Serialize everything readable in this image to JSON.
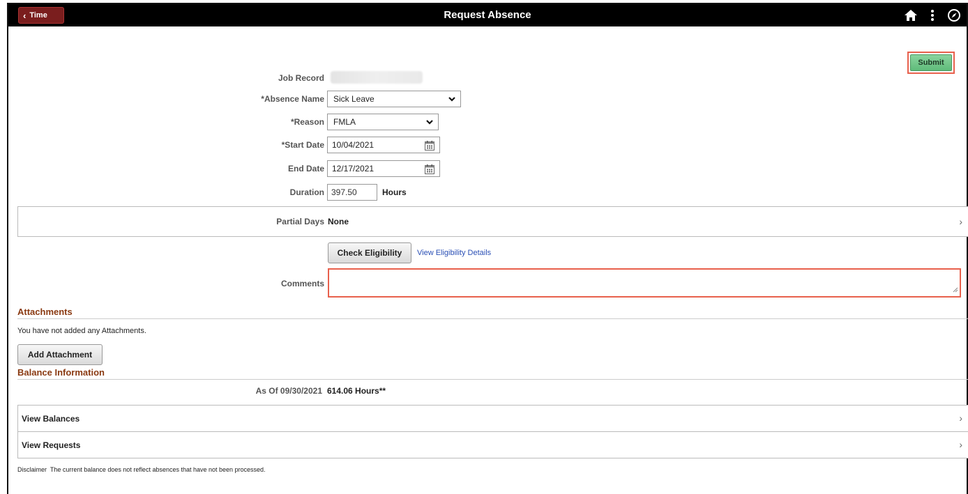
{
  "header": {
    "back_label": "Time",
    "title": "Request Absence",
    "icons": [
      "home-icon",
      "more-vertical-icon",
      "navigator-icon"
    ]
  },
  "actions": {
    "submit_label": "Submit"
  },
  "form": {
    "job_record_label": "Job Record",
    "absence_name_label": "*Absence Name",
    "absence_name_value": "Sick Leave",
    "reason_label": "*Reason",
    "reason_value": "FMLA",
    "start_date_label": "*Start Date",
    "start_date_value": "10/04/2021",
    "end_date_label": "End Date",
    "end_date_value": "12/17/2021",
    "duration_label": "Duration",
    "duration_value": "397.50",
    "duration_unit": "Hours",
    "partial_days_label": "Partial Days",
    "partial_days_value": "None",
    "check_eligibility_label": "Check Eligibility",
    "view_eligibility_link": "View Eligibility Details",
    "comments_label": "Comments",
    "comments_value": ""
  },
  "attachments": {
    "title": "Attachments",
    "empty_text": "You have not added any Attachments.",
    "add_label": "Add Attachment"
  },
  "balance": {
    "title": "Balance Information",
    "as_of_label": "As Of 09/30/2021",
    "as_of_value": "614.06 Hours**",
    "view_balances_label": "View Balances",
    "view_requests_label": "View Requests",
    "disclaimer_label": "Disclaimer",
    "disclaimer_text": "The current balance does not reflect absences that have not been processed."
  }
}
